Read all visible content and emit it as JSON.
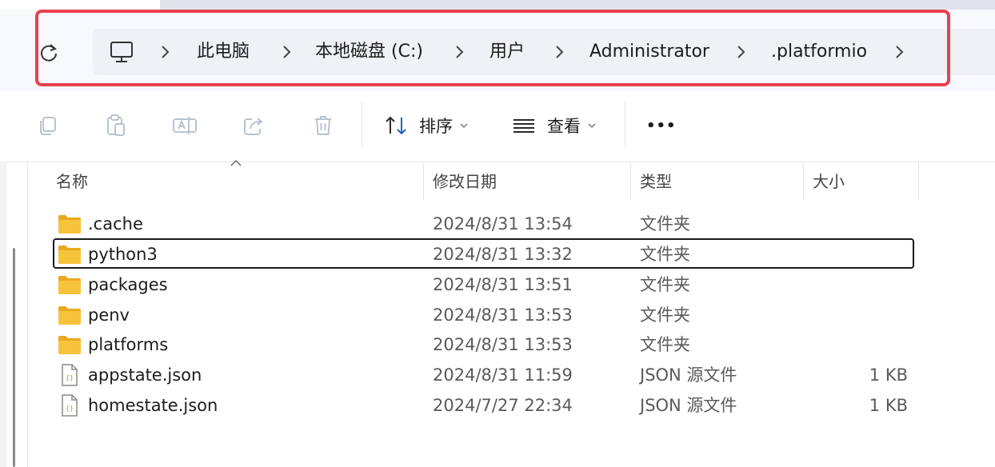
{
  "breadcrumb": {
    "items": [
      "此电脑",
      "本地磁盘 (C:)",
      "用户",
      "Administrator",
      ".platformio"
    ]
  },
  "toolbar": {
    "sort_label": "排序",
    "view_label": "查看",
    "more_label": "•••"
  },
  "columns": {
    "name": "名称",
    "modified": "修改日期",
    "type": "类型",
    "size": "大小"
  },
  "files": [
    {
      "name": ".cache",
      "modified": "2024/8/31 13:54",
      "type": "文件夹",
      "size": "",
      "icon": "folder-icon"
    },
    {
      "name": "python3",
      "modified": "2024/8/31 13:32",
      "type": "文件夹",
      "size": "",
      "icon": "folder-icon",
      "selected": true
    },
    {
      "name": "packages",
      "modified": "2024/8/31 13:51",
      "type": "文件夹",
      "size": "",
      "icon": "folder-icon"
    },
    {
      "name": "penv",
      "modified": "2024/8/31 13:53",
      "type": "文件夹",
      "size": "",
      "icon": "folder-icon"
    },
    {
      "name": "platforms",
      "modified": "2024/8/31 13:53",
      "type": "文件夹",
      "size": "",
      "icon": "folder-icon"
    },
    {
      "name": "appstate.json",
      "modified": "2024/8/31 11:59",
      "type": "JSON 源文件",
      "size": "1 KB",
      "icon": "json-file-icon"
    },
    {
      "name": "homestate.json",
      "modified": "2024/7/27 22:34",
      "type": "JSON 源文件",
      "size": "1 KB",
      "icon": "json-file-icon"
    }
  ],
  "colors": {
    "highlight": "#e8414f",
    "folder": "#f8c33c",
    "folder_dark": "#e9a91f"
  }
}
